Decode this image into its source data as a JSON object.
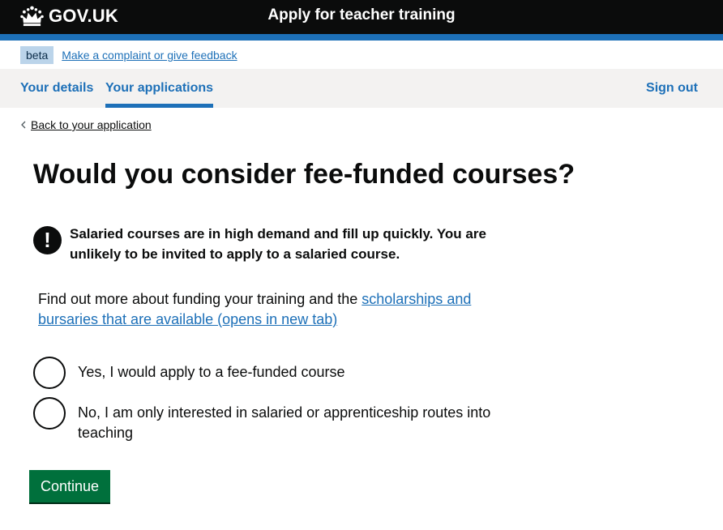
{
  "header": {
    "logo_text": "GOV.UK",
    "service_name": "Apply for teacher training"
  },
  "phase_banner": {
    "tag": "beta",
    "link": "Make a complaint or give feedback"
  },
  "nav": {
    "items": [
      {
        "label": "Your details"
      },
      {
        "label": "Your applications",
        "current": true
      }
    ],
    "sign_out": "Sign out"
  },
  "back_link": "Back to your application",
  "page_title": "Would you consider fee-funded courses?",
  "warning": {
    "icon": "!",
    "text": "Salaried courses are in high demand and fill up quickly. You are unlikely to be invited to apply to a salaried course."
  },
  "info": {
    "text": "Find out more about funding your training and the ",
    "link": "scholarships and bursaries that are available (opens in new tab)"
  },
  "options": [
    {
      "label": "Yes, I would apply to a fee-funded course",
      "selected": false
    },
    {
      "label": "No, I am only interested in salaried or apprenticeship routes into teaching",
      "selected": false
    }
  ],
  "continue_button": "Continue",
  "colors": {
    "header_bg": "#0b0c0c",
    "brand_blue": "#1d70b8",
    "button_green": "#00703c",
    "nav_bg": "#f3f2f1"
  }
}
